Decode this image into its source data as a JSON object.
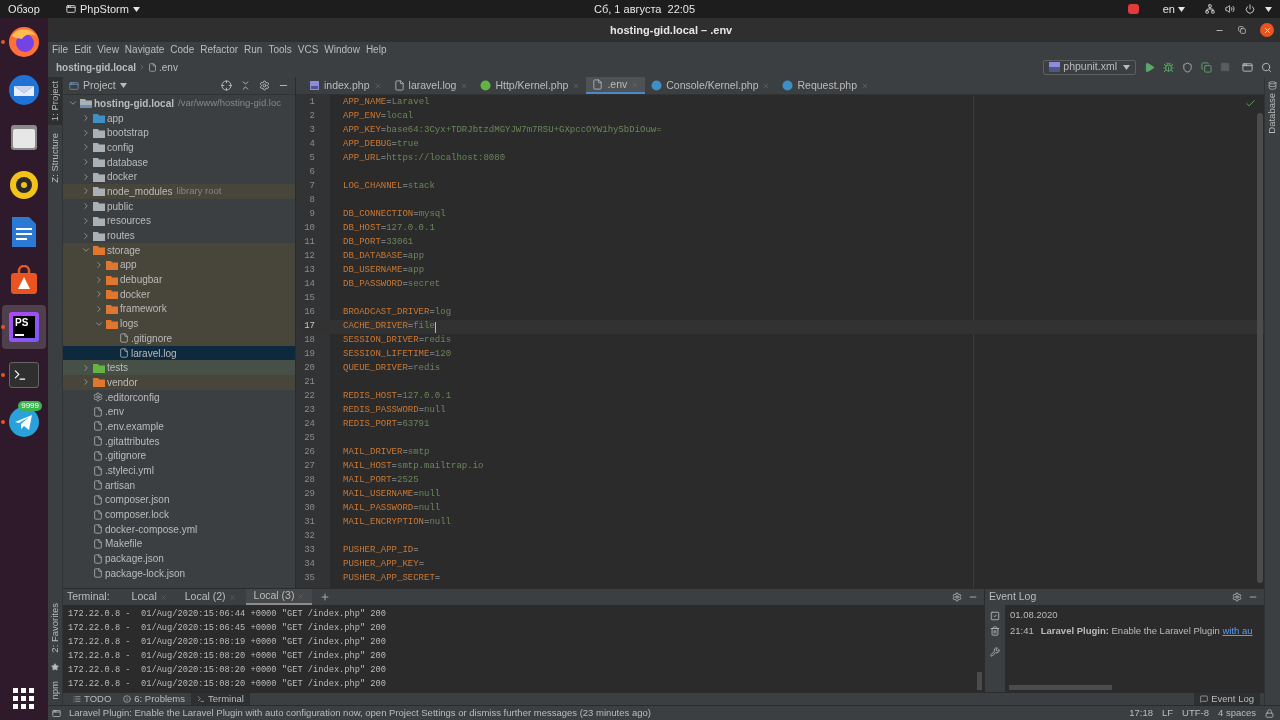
{
  "system_bar": {
    "activities": "Обзор",
    "app_name": "PhpStorm",
    "clock": "Сб, 1 августа  22:05",
    "language": "en"
  },
  "dock": [
    {
      "kind": "firefox",
      "running": true,
      "selected": false
    },
    {
      "kind": "mail",
      "running": false,
      "selected": false
    },
    {
      "kind": "files",
      "running": false,
      "selected": false
    },
    {
      "kind": "music",
      "running": false,
      "selected": false
    },
    {
      "kind": "writer",
      "running": false,
      "selected": false
    },
    {
      "kind": "store",
      "running": false,
      "selected": false
    },
    {
      "kind": "ide",
      "running": true,
      "selected": true,
      "logo_text": "PS"
    },
    {
      "kind": "terminal",
      "running": true,
      "selected": false
    },
    {
      "kind": "telegram",
      "running": true,
      "selected": false,
      "badge": "9999"
    }
  ],
  "window": {
    "title": "hosting-gid.local – .env"
  },
  "menu": [
    "File",
    "Edit",
    "View",
    "Navigate",
    "Code",
    "Refactor",
    "Run",
    "Tools",
    "VCS",
    "Window",
    "Help"
  ],
  "breadcrumb": [
    "hosting-gid.local",
    ".env"
  ],
  "run_config": "phpunit.xml",
  "left_strip": [
    "1: Project",
    "Z: Structure"
  ],
  "left_strip_bottom": [
    "2: Favorites",
    "npm"
  ],
  "right_strip": [
    "Database"
  ],
  "project": {
    "title": "Project",
    "tree": [
      {
        "name": "hosting-gid.local",
        "hint": "/var/www/hosting-gid.loc",
        "kind": "module",
        "expanded": true,
        "selected": false,
        "excluded": false,
        "test_sources": false,
        "children": [
          {
            "name": "app",
            "kind": "folder",
            "color": "#3d8fc6",
            "expanded": false,
            "selected": false,
            "excluded": false,
            "test_sources": false
          },
          {
            "name": "bootstrap",
            "kind": "folder",
            "color": "#a9b1b7",
            "expanded": false,
            "selected": false,
            "excluded": false,
            "test_sources": false
          },
          {
            "name": "config",
            "kind": "folder",
            "color": "#a9b1b7",
            "expanded": false,
            "selected": false,
            "excluded": false,
            "test_sources": false
          },
          {
            "name": "database",
            "kind": "folder",
            "color": "#a9b1b7",
            "expanded": false,
            "selected": false,
            "excluded": false,
            "test_sources": false
          },
          {
            "name": "docker",
            "kind": "folder",
            "color": "#a9b1b7",
            "expanded": false,
            "selected": false,
            "excluded": false,
            "test_sources": false
          },
          {
            "name": "node_modules",
            "hint": "library root",
            "kind": "folder",
            "color": "#a9b1b7",
            "expanded": false,
            "selected": false,
            "excluded": true,
            "test_sources": false
          },
          {
            "name": "public",
            "kind": "folder",
            "color": "#a9b1b7",
            "expanded": false,
            "selected": false,
            "excluded": false,
            "test_sources": false
          },
          {
            "name": "resources",
            "kind": "folder",
            "color": "#a9b1b7",
            "expanded": false,
            "selected": false,
            "excluded": false,
            "test_sources": false
          },
          {
            "name": "routes",
            "kind": "folder",
            "color": "#a9b1b7",
            "expanded": false,
            "selected": false,
            "excluded": false,
            "test_sources": false
          },
          {
            "name": "storage",
            "kind": "folder",
            "color": "#e0772f",
            "expanded": true,
            "selected": false,
            "excluded": true,
            "test_sources": false,
            "children": [
              {
                "name": "app",
                "kind": "folder",
                "color": "#e0772f",
                "expanded": false,
                "selected": false,
                "excluded": true,
                "test_sources": false
              },
              {
                "name": "debugbar",
                "kind": "folder",
                "color": "#e0772f",
                "expanded": false,
                "selected": false,
                "excluded": true,
                "test_sources": false
              },
              {
                "name": "docker",
                "kind": "folder",
                "color": "#e0772f",
                "expanded": false,
                "selected": false,
                "excluded": true,
                "test_sources": false
              },
              {
                "name": "framework",
                "kind": "folder",
                "color": "#e0772f",
                "expanded": false,
                "selected": false,
                "excluded": true,
                "test_sources": false
              },
              {
                "name": "logs",
                "kind": "folder",
                "color": "#e0772f",
                "expanded": true,
                "selected": false,
                "excluded": true,
                "test_sources": false,
                "children": [
                  {
                    "name": ".gitignore",
                    "kind": "file",
                    "selected": false,
                    "excluded": true,
                    "test_sources": false
                  },
                  {
                    "name": "laravel.log",
                    "kind": "file",
                    "selected": true,
                    "excluded": true,
                    "test_sources": false
                  }
                ]
              }
            ]
          },
          {
            "name": "tests",
            "kind": "folder",
            "color": "#62b543",
            "expanded": false,
            "selected": false,
            "excluded": false,
            "test_sources": true
          },
          {
            "name": "vendor",
            "kind": "folder",
            "color": "#e0772f",
            "expanded": false,
            "selected": false,
            "excluded": true,
            "test_sources": false
          },
          {
            "name": ".editorconfig",
            "kind": "config",
            "selected": false,
            "excluded": false,
            "test_sources": false
          },
          {
            "name": ".env",
            "kind": "file",
            "selected": false,
            "excluded": false,
            "test_sources": false
          },
          {
            "name": ".env.example",
            "kind": "file",
            "selected": false,
            "excluded": false,
            "test_sources": false
          },
          {
            "name": ".gitattributes",
            "kind": "file",
            "selected": false,
            "excluded": false,
            "test_sources": false
          },
          {
            "name": ".gitignore",
            "kind": "file",
            "selected": false,
            "excluded": false,
            "test_sources": false
          },
          {
            "name": ".styleci.yml",
            "kind": "file",
            "selected": false,
            "excluded": false,
            "test_sources": false
          },
          {
            "name": "artisan",
            "kind": "file",
            "selected": false,
            "excluded": false,
            "test_sources": false
          },
          {
            "name": "composer.json",
            "kind": "file",
            "selected": false,
            "excluded": false,
            "test_sources": false
          },
          {
            "name": "composer.lock",
            "kind": "file",
            "selected": false,
            "excluded": false,
            "test_sources": false
          },
          {
            "name": "docker-compose.yml",
            "kind": "file",
            "selected": false,
            "excluded": false,
            "test_sources": false
          },
          {
            "name": "Makefile",
            "kind": "file",
            "selected": false,
            "excluded": false,
            "test_sources": false
          },
          {
            "name": "package.json",
            "kind": "file",
            "selected": false,
            "excluded": false,
            "test_sources": false
          },
          {
            "name": "package-lock.json",
            "kind": "file",
            "selected": false,
            "excluded": false,
            "test_sources": false
          }
        ]
      }
    ]
  },
  "tabs": [
    {
      "label": "index.php",
      "kind": "php",
      "selected": false
    },
    {
      "label": "laravel.log",
      "kind": "text",
      "selected": false
    },
    {
      "label": "Http/Kernel.php",
      "kind": "class",
      "color": "#62b543",
      "selected": false
    },
    {
      "label": ".env",
      "kind": "text",
      "selected": true
    },
    {
      "label": "Console/Kernel.php",
      "kind": "class",
      "color": "#3d8fc6",
      "selected": false
    },
    {
      "label": "Request.php",
      "kind": "class",
      "color": "#3d8fc6",
      "selected": false
    }
  ],
  "editor": {
    "lines": [
      {
        "number": "1",
        "text": "APP_NAME=Laravel",
        "current": false
      },
      {
        "number": "2",
        "text": "APP_ENV=local",
        "current": false
      },
      {
        "number": "3",
        "text": "APP_KEY=base64:3Cyx+TDRJbtzdMGYJW7m7RSU+GXpccOYW1hy5bDiOuw=",
        "current": false
      },
      {
        "number": "4",
        "text": "APP_DEBUG=true",
        "current": false
      },
      {
        "number": "5",
        "text": "APP_URL=https://localhost:8080",
        "current": false
      },
      {
        "number": "6",
        "current": false
      },
      {
        "number": "7",
        "text": "LOG_CHANNEL=stack",
        "current": false
      },
      {
        "number": "8",
        "current": false
      },
      {
        "number": "9",
        "text": "DB_CONNECTION=mysql",
        "current": false
      },
      {
        "number": "10",
        "text": "DB_HOST=127.0.0.1",
        "current": false
      },
      {
        "number": "11",
        "text": "DB_PORT=33061",
        "current": false
      },
      {
        "number": "12",
        "text": "DB_DATABASE=app",
        "current": false
      },
      {
        "number": "13",
        "text": "DB_USERNAME=app",
        "current": false
      },
      {
        "number": "14",
        "text": "DB_PASSWORD=secret",
        "current": false
      },
      {
        "number": "15",
        "current": false
      },
      {
        "number": "16",
        "text": "BROADCAST_DRIVER=log",
        "current": false
      },
      {
        "number": "17",
        "text": "CACHE_DRIVER=file",
        "current": true
      },
      {
        "number": "18",
        "text": "SESSION_DRIVER=redis",
        "current": false
      },
      {
        "number": "19",
        "text": "SESSION_LIFETIME=120",
        "current": false
      },
      {
        "number": "20",
        "text": "QUEUE_DRIVER=redis",
        "current": false
      },
      {
        "number": "21",
        "current": false
      },
      {
        "number": "22",
        "text": "REDIS_HOST=127.0.0.1",
        "current": false
      },
      {
        "number": "23",
        "text": "REDIS_PASSWORD=null",
        "current": false
      },
      {
        "number": "24",
        "text": "REDIS_PORT=63791",
        "current": false
      },
      {
        "number": "25",
        "current": false
      },
      {
        "number": "26",
        "text": "MAIL_DRIVER=smtp",
        "current": false
      },
      {
        "number": "27",
        "text": "MAIL_HOST=smtp.mailtrap.io",
        "current": false
      },
      {
        "number": "28",
        "text": "MAIL_PORT=2525",
        "current": false
      },
      {
        "number": "29",
        "text": "MAIL_USERNAME=null",
        "current": false
      },
      {
        "number": "30",
        "text": "MAIL_PASSWORD=null",
        "current": false
      },
      {
        "number": "31",
        "text": "MAIL_ENCRYPTION=null",
        "current": false
      },
      {
        "number": "32",
        "current": false
      },
      {
        "number": "33",
        "text": "PUSHER_APP_ID=",
        "current": false
      },
      {
        "number": "34",
        "text": "PUSHER_APP_KEY=",
        "current": false
      },
      {
        "number": "35",
        "text": "PUSHER_APP_SECRET=",
        "current": false
      }
    ]
  },
  "terminal": {
    "label": "Terminal:",
    "tabs": [
      {
        "label": "Local",
        "selected": false
      },
      {
        "label": "Local (2)",
        "selected": false
      },
      {
        "label": "Local (3)",
        "selected": true
      }
    ],
    "lines": [
      "172.22.0.8 -  01/Aug/2020:15:06:44 +0000 \"GET /index.php\" 200",
      "172.22.0.8 -  01/Aug/2020:15:06:45 +0000 \"GET /index.php\" 200",
      "172.22.0.8 -  01/Aug/2020:15:08:19 +0000 \"GET /index.php\" 200",
      "172.22.0.8 -  01/Aug/2020:15:08:20 +0000 \"GET /index.php\" 200",
      "172.22.0.8 -  01/Aug/2020:15:08:20 +0000 \"GET /index.php\" 200",
      "172.22.0.8 -  01/Aug/2020:15:08:20 +0000 \"GET /index.php\" 200"
    ]
  },
  "event_log": {
    "title": "Event Log",
    "date": "01.08.2020",
    "entries": [
      {
        "time": "21:41",
        "message": "**Laravel Plugin:** Enable the Laravel Plugin",
        "link": "with au"
      }
    ]
  },
  "bottom_tabs": [
    {
      "label": "TODO",
      "kind": "list",
      "selected": false
    },
    {
      "label": "6: Problems",
      "kind": "info",
      "selected": false
    },
    {
      "label": "Terminal",
      "kind": "terminal",
      "selected": true
    }
  ],
  "bottom_right_tab": "Event Log",
  "status_bar": {
    "message": "Laravel Plugin: Enable the Laravel Plugin with auto configuration now, open Project Settings or dismiss further messages (23 minutes ago)",
    "position": "17:18",
    "line_ending": "LF",
    "encoding": "UTF-8",
    "indent": "4 spaces"
  }
}
